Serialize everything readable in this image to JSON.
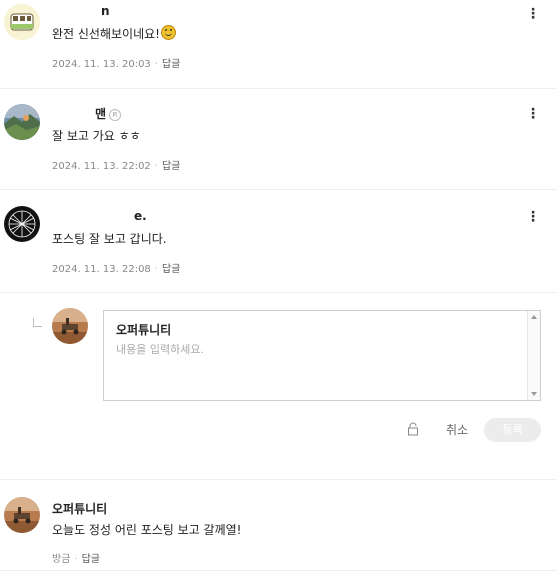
{
  "comments": [
    {
      "author": "n",
      "text": "완전 신선해보이네요!",
      "emoji": "smiling-face",
      "date": "2024. 11. 13. 20:03",
      "reply_label": "답글"
    },
    {
      "author": "맨",
      "badge": "R",
      "text": "잘 보고 가요 ㅎㅎ",
      "date": "2024. 11. 13. 22:02",
      "reply_label": "답글"
    },
    {
      "author": "e.",
      "text": "포스팅 잘 보고 갑니다.",
      "date": "2024. 11. 13. 22:08",
      "reply_label": "답글"
    }
  ],
  "reply_form": {
    "author": "오퍼튜니티",
    "placeholder": "내용을 입력하세요.",
    "cancel_label": "취소",
    "submit_label": "등록",
    "lock_icon": "lock-icon"
  },
  "my_comment": {
    "author": "오퍼튜니티",
    "text": "오늘도 정성 어린 포스팅 보고 갈께열!",
    "date": "방금",
    "reply_label": "답글"
  },
  "icons": {
    "more": "more-vertical-icon",
    "reply_indent": "reply-indent-icon"
  },
  "colors": {
    "meta_text": "#888888",
    "divider": "#eeeeee",
    "submit_bg": "#ececec"
  }
}
